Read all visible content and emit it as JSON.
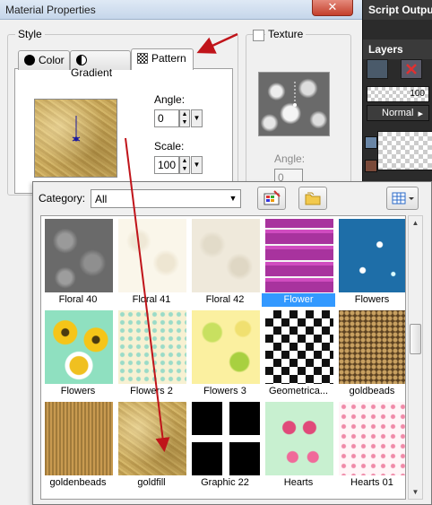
{
  "window": {
    "title": "Material Properties",
    "close_glyph": "✕"
  },
  "right_panel": {
    "script_output_title": "Script Output",
    "layers_title": "Layers",
    "opacity_value": "100",
    "blend_mode": "Normal",
    "blend_arrow": "▸"
  },
  "style": {
    "group_label": "Style",
    "tabs": [
      {
        "label": "Color",
        "icon": "filled-circle-icon"
      },
      {
        "label": "Gradient",
        "icon": "half-circle-icon"
      },
      {
        "label": "Pattern",
        "icon": "pattern-icon",
        "active": true
      }
    ],
    "angle_label": "Angle:",
    "angle_value": "0",
    "scale_label": "Scale:",
    "scale_value": "100"
  },
  "texture": {
    "checkbox_label": "Texture",
    "checked": false,
    "angle_label": "Angle:",
    "angle_value": "0"
  },
  "picker": {
    "category_label": "Category:",
    "category_value": "All",
    "items": [
      {
        "label": "Floral 40",
        "selected": false
      },
      {
        "label": "Floral 41",
        "selected": false
      },
      {
        "label": "Floral 42",
        "selected": false
      },
      {
        "label": "Flower",
        "selected": true
      },
      {
        "label": "Flowers",
        "selected": false
      },
      {
        "label": "Flowers",
        "selected": false
      },
      {
        "label": "Flowers 2",
        "selected": false
      },
      {
        "label": "Flowers 3",
        "selected": false
      },
      {
        "label": "Geometrica...",
        "selected": false
      },
      {
        "label": "goldbeads",
        "selected": false
      },
      {
        "label": "goldenbeads",
        "selected": false
      },
      {
        "label": "goldfill",
        "selected": false
      },
      {
        "label": "Graphic 22",
        "selected": false
      },
      {
        "label": "Hearts",
        "selected": false
      },
      {
        "label": "Hearts 01",
        "selected": false
      }
    ]
  },
  "colors": {
    "annotation_arrow": "#c0141a",
    "selection_highlight": "#3399ff"
  }
}
